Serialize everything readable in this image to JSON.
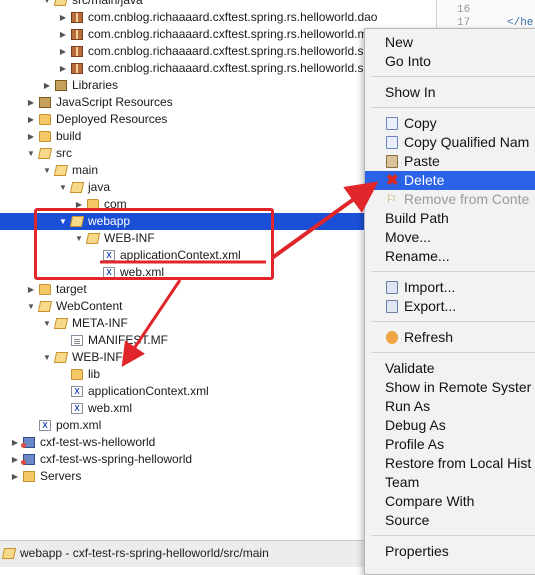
{
  "tree": {
    "rows": [
      {
        "id": "srcmainjava",
        "label": "src/main/java",
        "indent": 2,
        "twisty": "open",
        "icon": "folder-open"
      },
      {
        "id": "pkg1",
        "label": "com.cnblog.richaaaard.cxftest.spring.rs.helloworld.dao",
        "indent": 3,
        "twisty": "closed",
        "icon": "pkg"
      },
      {
        "id": "pkg2",
        "label": "com.cnblog.richaaaard.cxftest.spring.rs.helloworld.m",
        "indent": 3,
        "twisty": "closed",
        "icon": "pkg"
      },
      {
        "id": "pkg3",
        "label": "com.cnblog.richaaaard.cxftest.spring.rs.helloworld.s",
        "indent": 3,
        "twisty": "closed",
        "icon": "pkg"
      },
      {
        "id": "pkg4",
        "label": "com.cnblog.richaaaard.cxftest.spring.rs.helloworld.s",
        "indent": 3,
        "twisty": "closed",
        "icon": "pkg"
      },
      {
        "id": "libraries",
        "label": "Libraries",
        "indent": 2,
        "twisty": "closed",
        "icon": "lib"
      },
      {
        "id": "jsres",
        "label": "JavaScript Resources",
        "indent": 1,
        "twisty": "closed",
        "icon": "lib"
      },
      {
        "id": "deployed",
        "label": "Deployed Resources",
        "indent": 1,
        "twisty": "closed",
        "icon": "folder"
      },
      {
        "id": "build",
        "label": "build",
        "indent": 1,
        "twisty": "closed",
        "icon": "folder"
      },
      {
        "id": "src",
        "label": "src",
        "indent": 1,
        "twisty": "open",
        "icon": "folder-open"
      },
      {
        "id": "main",
        "label": "main",
        "indent": 2,
        "twisty": "open",
        "icon": "folder-open"
      },
      {
        "id": "java",
        "label": "java",
        "indent": 3,
        "twisty": "open",
        "icon": "folder-open"
      },
      {
        "id": "com",
        "label": "com",
        "indent": 4,
        "twisty": "closed",
        "icon": "folder"
      },
      {
        "id": "webapp",
        "label": "webapp",
        "indent": 3,
        "twisty": "open",
        "icon": "folder-open",
        "selected": true
      },
      {
        "id": "webinf1",
        "label": "WEB-INF",
        "indent": 4,
        "twisty": "open",
        "icon": "folder-open"
      },
      {
        "id": "appctx1",
        "label": "applicationContext.xml",
        "indent": 5,
        "twisty": "",
        "icon": "xml"
      },
      {
        "id": "webxml1",
        "label": "web.xml",
        "indent": 5,
        "twisty": "",
        "icon": "xml"
      },
      {
        "id": "target",
        "label": "target",
        "indent": 1,
        "twisty": "closed",
        "icon": "folder"
      },
      {
        "id": "webcontent",
        "label": "WebContent",
        "indent": 1,
        "twisty": "open",
        "icon": "folder-open"
      },
      {
        "id": "metainf",
        "label": "META-INF",
        "indent": 2,
        "twisty": "open",
        "icon": "folder-open"
      },
      {
        "id": "manifest",
        "label": "MANIFEST.MF",
        "indent": 3,
        "twisty": "",
        "icon": "mf"
      },
      {
        "id": "webinf2",
        "label": "WEB-INF",
        "indent": 2,
        "twisty": "open",
        "icon": "folder-open"
      },
      {
        "id": "lib",
        "label": "lib",
        "indent": 3,
        "twisty": "",
        "icon": "folder"
      },
      {
        "id": "appctx2",
        "label": "applicationContext.xml",
        "indent": 3,
        "twisty": "",
        "icon": "xml"
      },
      {
        "id": "webxml2",
        "label": "web.xml",
        "indent": 3,
        "twisty": "",
        "icon": "xml"
      },
      {
        "id": "pom",
        "label": "pom.xml",
        "indent": 1,
        "twisty": "",
        "icon": "xml"
      },
      {
        "id": "proj1",
        "label": "cxf-test-ws-helloworld",
        "indent": 0,
        "twisty": "closed",
        "icon": "proj"
      },
      {
        "id": "proj2",
        "label": "cxf-test-ws-spring-helloworld",
        "indent": 0,
        "twisty": "closed",
        "icon": "proj"
      },
      {
        "id": "servers",
        "label": "Servers",
        "indent": 0,
        "twisty": "closed",
        "icon": "srv"
      }
    ]
  },
  "editor": {
    "line_numbers": [
      "16",
      "17"
    ],
    "code": "</he"
  },
  "status": {
    "text": "webapp - cxf-test-rs-spring-helloworld/src/main"
  },
  "menu": {
    "items": [
      {
        "label": "New",
        "icon": "",
        "state": "normal"
      },
      {
        "label": "Go Into",
        "icon": "",
        "state": "normal"
      },
      {
        "sep": true
      },
      {
        "label": "Show In",
        "icon": "",
        "state": "normal"
      },
      {
        "sep": true
      },
      {
        "label": "Copy",
        "icon": "copy",
        "state": "normal"
      },
      {
        "label": "Copy Qualified Nam",
        "icon": "copyq",
        "state": "normal"
      },
      {
        "label": "Paste",
        "icon": "paste",
        "state": "normal"
      },
      {
        "label": "Delete",
        "icon": "del",
        "state": "highlighted"
      },
      {
        "label": "Remove from Conte",
        "icon": "remove",
        "state": "disabled"
      },
      {
        "label": "Build Path",
        "icon": "",
        "state": "normal"
      },
      {
        "label": "Move...",
        "icon": "",
        "state": "normal"
      },
      {
        "label": "Rename...",
        "icon": "",
        "state": "normal"
      },
      {
        "sep": true
      },
      {
        "label": "Import...",
        "icon": "imp",
        "state": "normal"
      },
      {
        "label": "Export...",
        "icon": "exp",
        "state": "normal"
      },
      {
        "sep": true
      },
      {
        "label": "Refresh",
        "icon": "ref",
        "state": "normal"
      },
      {
        "sep": true
      },
      {
        "label": "Validate",
        "icon": "",
        "state": "normal"
      },
      {
        "label": "Show in Remote Syster",
        "icon": "",
        "state": "normal"
      },
      {
        "label": "Run As",
        "icon": "",
        "state": "normal"
      },
      {
        "label": "Debug As",
        "icon": "",
        "state": "normal"
      },
      {
        "label": "Profile As",
        "icon": "",
        "state": "normal"
      },
      {
        "label": "Restore from Local Hist",
        "icon": "",
        "state": "normal"
      },
      {
        "label": "Team",
        "icon": "",
        "state": "normal"
      },
      {
        "label": "Compare With",
        "icon": "",
        "state": "normal"
      },
      {
        "label": "Source",
        "icon": "",
        "state": "normal"
      },
      {
        "sep": true
      },
      {
        "label": "Properties",
        "icon": "",
        "state": "normal"
      }
    ]
  },
  "annotation": {
    "color": "#e0262a"
  },
  "colors": {
    "selection": "#1b4fd6",
    "menu_highlight": "#2a62e8"
  }
}
